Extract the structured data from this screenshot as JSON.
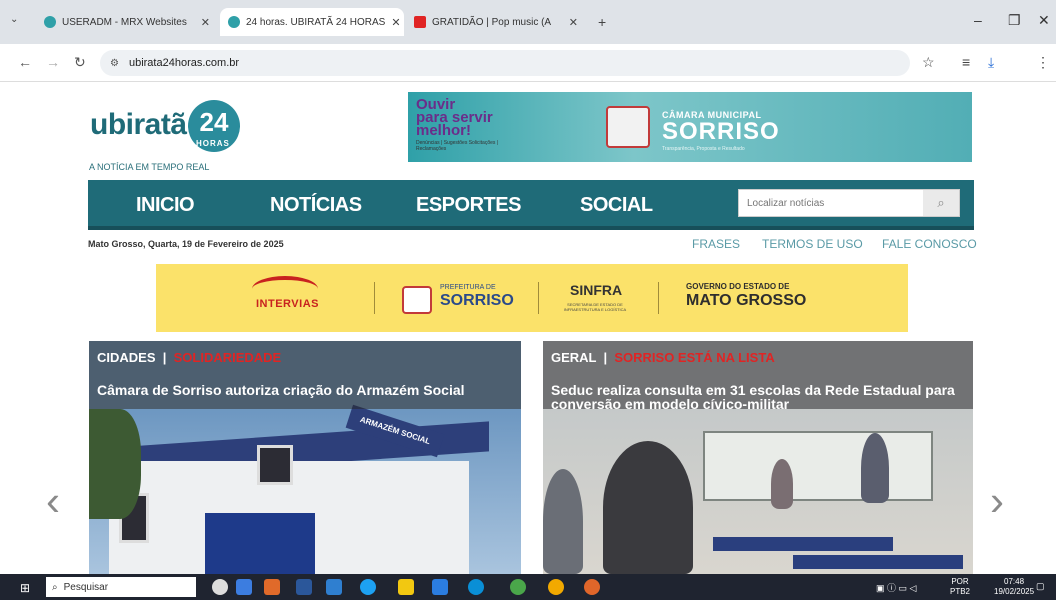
{
  "browser": {
    "tabs": [
      {
        "title": "USERADM - MRX Websites",
        "favicon_color": "#2fa0a8",
        "active": false
      },
      {
        "title": "24 horas. UBIRATÃ 24 HORAS",
        "favicon_color": "#2fa0a8",
        "active": true
      },
      {
        "title": "GRATIDÃO | Pop music (A",
        "favicon_color": "#e02424",
        "active": false
      }
    ],
    "url": "ubirata24horas.com.br"
  },
  "site": {
    "logo_text": "ubiratã",
    "logo_badge": "24",
    "logo_badge_sub": "HORAS",
    "tagline": "A NOTÍCIA EM TEMPO REAL",
    "top_ad": {
      "line1": "Ouvir",
      "line2": "para servir",
      "line3": "melhor!",
      "small": "Denúncias | Sugestões Solicitações | Reclamações",
      "camara": "CÂMARA MUNICIPAL",
      "sorriso": "SORRISO",
      "sorriso_sub": "Transparência, Proposta e Resultado"
    },
    "nav": [
      "INICIO",
      "NOTÍCIAS",
      "ESPORTES",
      "SOCIAL"
    ],
    "search_placeholder": "Localizar notícias",
    "date": "Mato Grosso, Quarta, 19 de Fevereiro de 2025",
    "links": [
      "FRASES",
      "TERMOS DE USO",
      "FALE CONOSCO"
    ],
    "mid_ad": {
      "intervias": "INTERVIAS",
      "pref": "PREFEITURA DE",
      "psorriso": "SORRISO",
      "sinfra": "SINFRA",
      "sinfra_sub": "SECRETARIA DE ESTADO DE INFRAESTRUTURA E LOGÍSTICA",
      "gov": "GOVERNO DO ESTADO DE",
      "mt": "MATO GROSSO"
    },
    "cards": [
      {
        "category": "CIDADES",
        "subcategory": "SOLIDARIEDADE",
        "title": "Câmara de Sorriso autoriza criação do Armazém Social",
        "sign": "ARMAZÉM SOCIAL"
      },
      {
        "category": "GERAL",
        "subcategory": "SORRISO ESTÁ NA LISTA",
        "title": "Seduc realiza consulta em 31 escolas da Rede Estadual para conversão em modelo cívico-militar"
      }
    ]
  },
  "taskbar": {
    "search_label": "Pesquisar",
    "lang": "POR",
    "lang2": "PTB2",
    "time": "07:48",
    "date": "19/02/2025"
  },
  "colors": {
    "brand": "#1f6b78",
    "accent_red": "#e02424",
    "ad_yellow": "#fbe26a"
  }
}
